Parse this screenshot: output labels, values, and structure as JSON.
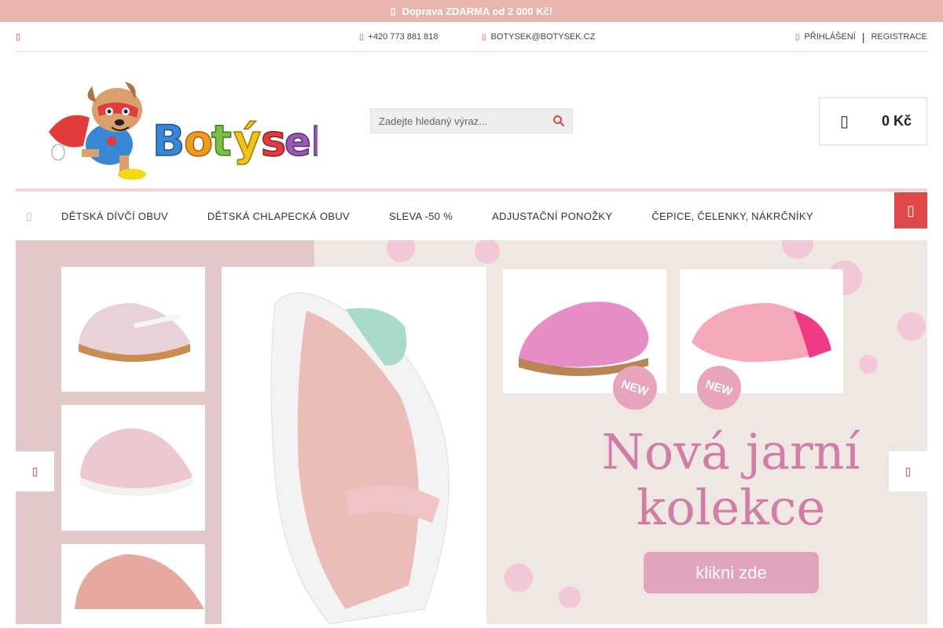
{
  "promo": {
    "icon": "truck-icon",
    "text": "Doprava ZDARMA od 2 000 Kč!"
  },
  "topbar": {
    "phone": "+420 773 881 818",
    "email": "BOTYSEK@BOTYSEK.CZ",
    "login": "PŘIHLÁŠENÍ",
    "separator": "|",
    "register": "REGISTRACE"
  },
  "header": {
    "search_placeholder": "Zadejte hledaný výraz...",
    "cart_total": "0 Kč"
  },
  "nav": {
    "items": [
      "DĚTSKÁ DÍVČÍ OBUV",
      "DĚTSKÁ CHLAPECKÁ OBUV",
      "SLEVA -50 %",
      "ADJUSTAČNÍ PONOŽKY",
      "ČEPICE, ČELENKY, NÁKRČNÍKY"
    ]
  },
  "banner": {
    "headline_line1": "Nová jarní",
    "headline_line2": "kolekce",
    "cta": "klikni zde",
    "badge_text": "NEW"
  },
  "colors": {
    "promo_bg": "#e8b4ae",
    "accent_red": "#e0484a",
    "headline_pink": "#d27ca8",
    "cta_pink": "#e0a4bc"
  }
}
